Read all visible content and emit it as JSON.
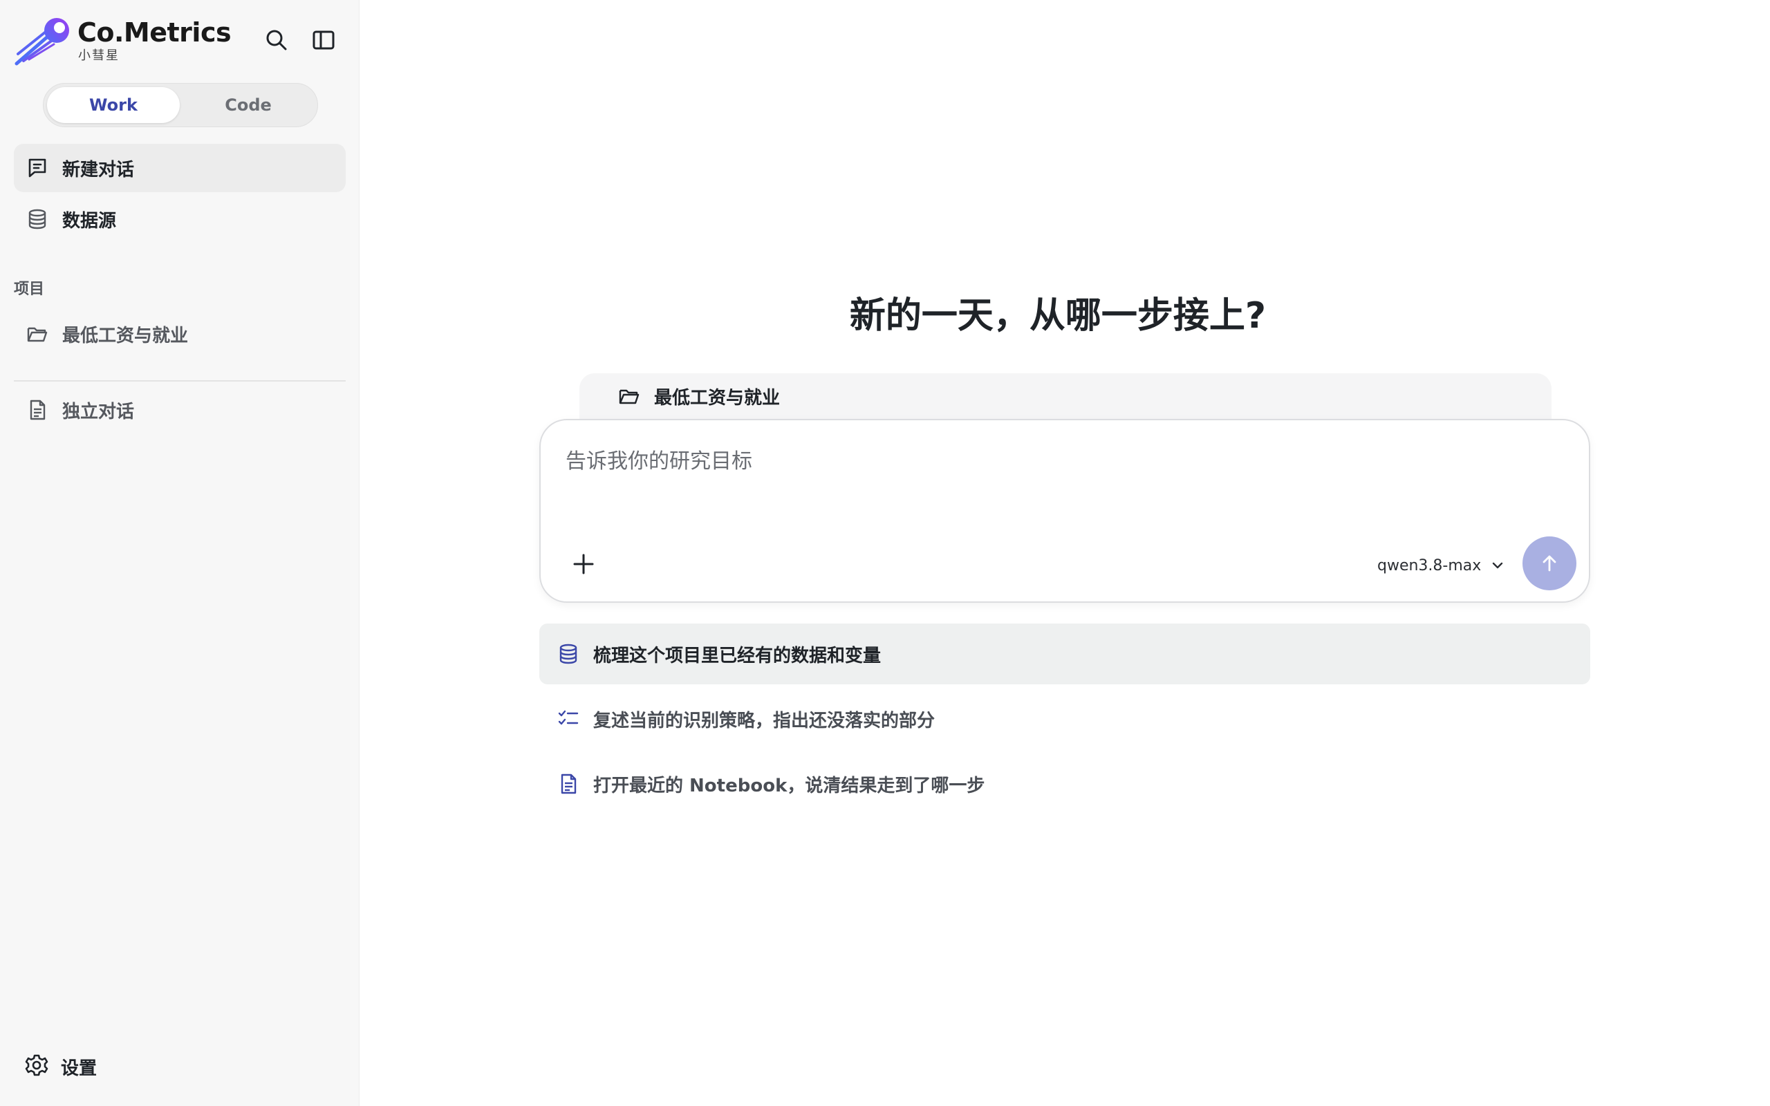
{
  "brand": {
    "name": "Co.Metrics",
    "subtitle": "小彗星"
  },
  "mode_switch": {
    "work": "Work",
    "code": "Code",
    "active": "Work"
  },
  "nav": {
    "new_chat": "新建对话",
    "data_source": "数据源"
  },
  "projects": {
    "section_label": "项目",
    "items": [
      {
        "label": "最低工资与就业"
      }
    ]
  },
  "standalone": {
    "label": "独立对话"
  },
  "settings": {
    "label": "设置"
  },
  "main": {
    "headline": "新的一天，从哪一步接上?",
    "project_tab": "最低工资与就业",
    "input": {
      "placeholder": "告诉我你的研究目标",
      "value": ""
    },
    "model": "qwen3.8-max",
    "suggestions": [
      {
        "label": "梳理这个项目里已经有的数据和变量",
        "icon": "database-icon"
      },
      {
        "label": "复述当前的识别策略，指出还没落实的部分",
        "icon": "checklist-icon"
      },
      {
        "label": "打开最近的 Notebook，说清结果走到了哪一步",
        "icon": "document-icon"
      }
    ]
  },
  "colors": {
    "accent": "#3b47a8",
    "send_button": "#a9b0e2",
    "sidebar_bg": "#f7f7f7"
  }
}
